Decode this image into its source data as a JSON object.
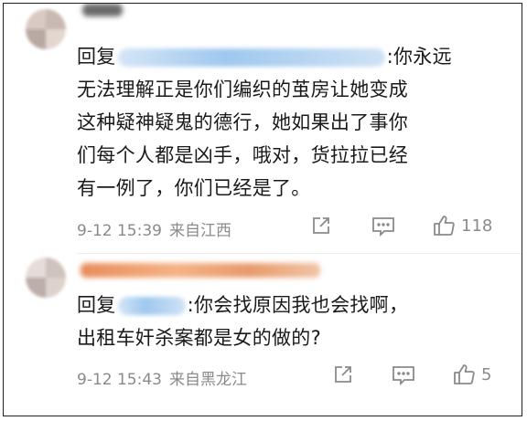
{
  "comments": [
    {
      "username": "",
      "reply_prefix": "回复",
      "reply_mention_suffix": ":你永远",
      "lines": [
        "无法理解正是你们编织的茧房让她变成",
        "这种疑神疑鬼的德行，她如果出了事你",
        "们每个人都是凶手，哦对，货拉拉已经",
        "有一例了，你们已经是了。"
      ],
      "date": "9-12 15:39",
      "location": "来自江西",
      "like_count": "118"
    },
    {
      "username": "",
      "reply_prefix": "回复",
      "reply_mention_suffix": ":你会找原因我也会找啊，",
      "lines": [
        "出租车奸杀案都是女的做的?"
      ],
      "date": "9-12 15:43",
      "location": "来自黑龙江",
      "like_count": "5"
    }
  ],
  "icons": {
    "share": "share-icon",
    "comment": "comment-icon",
    "like": "thumbs-up-icon"
  },
  "colors": {
    "text": "#1a1a1a",
    "meta": "#8a8a8a",
    "mention_blur": "#9fc8ee"
  }
}
